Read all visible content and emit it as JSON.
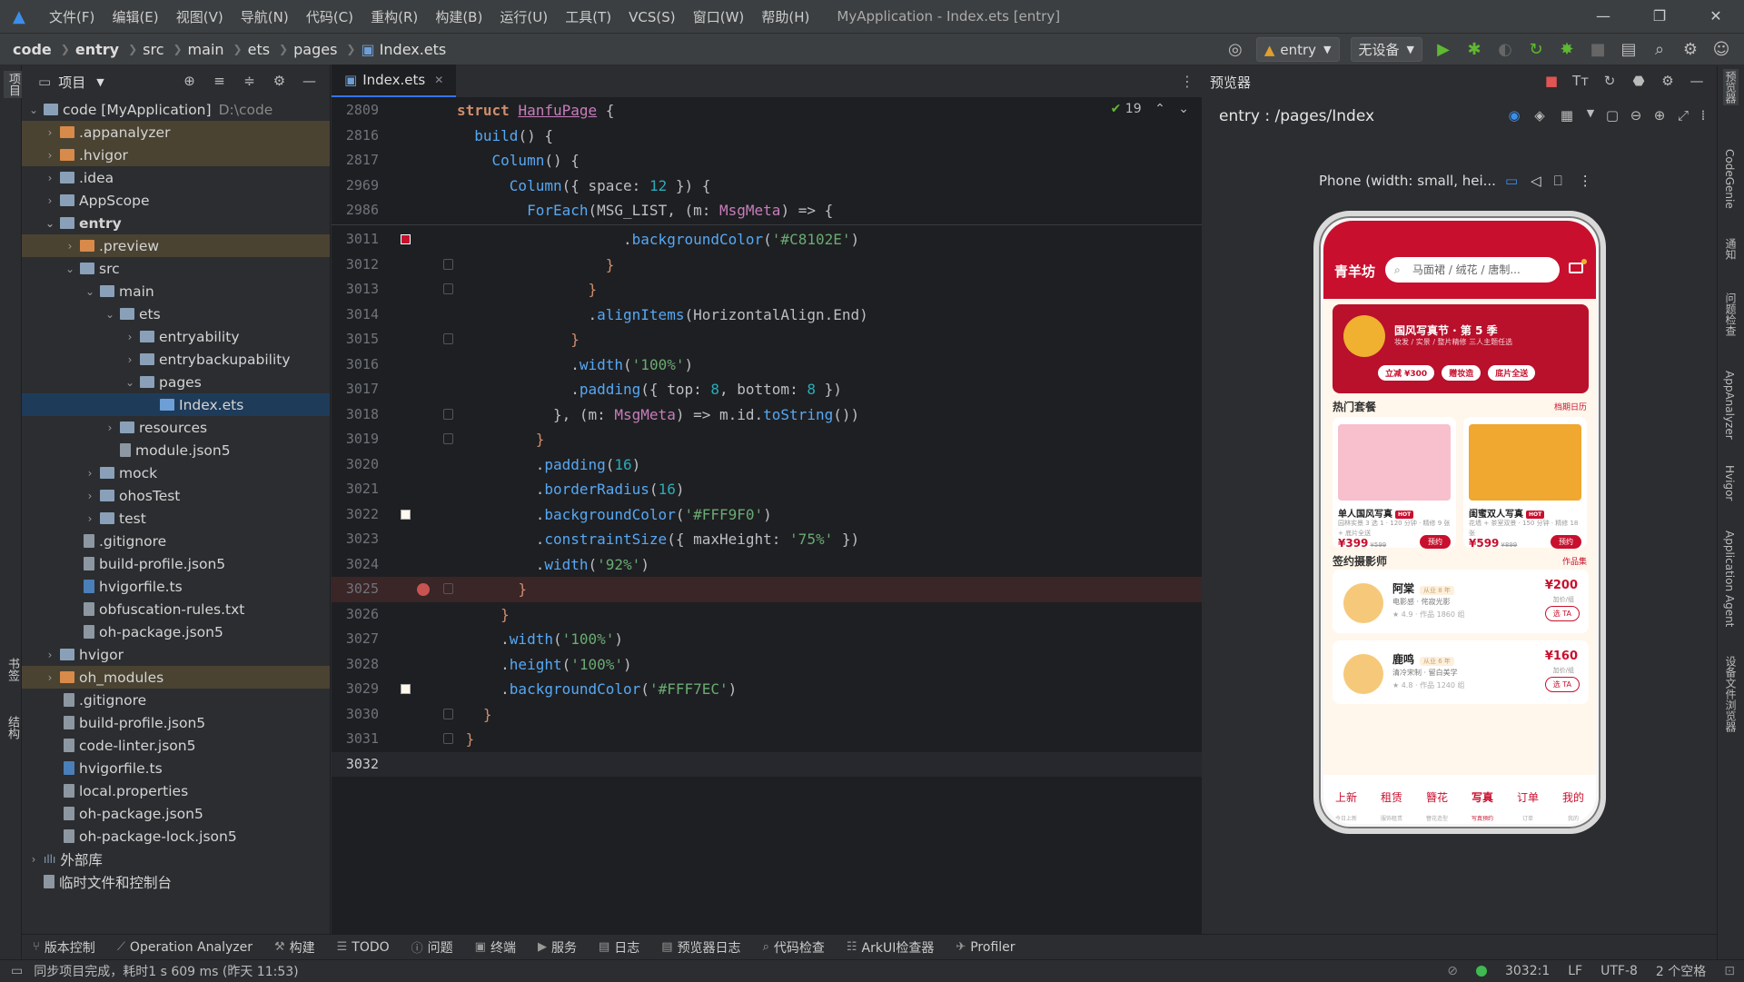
{
  "app": {
    "menu": [
      "文件(F)",
      "编辑(E)",
      "视图(V)",
      "导航(N)",
      "代码(C)",
      "重构(R)",
      "构建(B)",
      "运行(U)",
      "工具(T)",
      "VCS(S)",
      "窗口(W)",
      "帮助(H)"
    ],
    "window_title": "MyApplication - Index.ets [entry]"
  },
  "breadcrumb": [
    "code",
    "entry",
    "src",
    "main",
    "ets",
    "pages",
    "Index.ets"
  ],
  "toolbar": {
    "module": "entry",
    "device": "无设备"
  },
  "project": {
    "title": "项目",
    "tree": [
      {
        "label": "code [MyApplication]",
        "note": "D:\\code"
      },
      {
        "label": ".appanalyzer"
      },
      {
        "label": ".hvigor"
      },
      {
        "label": ".idea"
      },
      {
        "label": "AppScope"
      },
      {
        "label": "entry"
      },
      {
        "label": ".preview"
      },
      {
        "label": "src"
      },
      {
        "label": "main"
      },
      {
        "label": "ets"
      },
      {
        "label": "entryability"
      },
      {
        "label": "entrybackupability"
      },
      {
        "label": "pages"
      },
      {
        "label": "Index.ets"
      },
      {
        "label": "resources"
      },
      {
        "label": "module.json5"
      },
      {
        "label": "mock"
      },
      {
        "label": "ohosTest"
      },
      {
        "label": "test"
      },
      {
        "label": ".gitignore"
      },
      {
        "label": "build-profile.json5"
      },
      {
        "label": "hvigorfile.ts"
      },
      {
        "label": "obfuscation-rules.txt"
      },
      {
        "label": "oh-package.json5"
      },
      {
        "label": "hvigor"
      },
      {
        "label": "oh_modules"
      },
      {
        "label": ".gitignore"
      },
      {
        "label": "build-profile.json5"
      },
      {
        "label": "code-linter.json5"
      },
      {
        "label": "hvigorfile.ts"
      },
      {
        "label": "local.properties"
      },
      {
        "label": "oh-package.json5"
      },
      {
        "label": "oh-package-lock.json5"
      },
      {
        "label": "外部库"
      },
      {
        "label": "临时文件和控制台"
      }
    ]
  },
  "editor": {
    "tab": "Index.ets",
    "inspection_count": "19",
    "sticky": [
      {
        "n": "2809",
        "code": "struct HanfuPage {"
      },
      {
        "n": "2816",
        "code": "  build() {"
      },
      {
        "n": "2817",
        "code": "    Column() {"
      },
      {
        "n": "2969",
        "code": "      Column({ space: 12 }) {"
      },
      {
        "n": "2986",
        "code": "        ForEach(MSG_LIST, (m: MsgMeta) => {"
      }
    ],
    "lines": [
      {
        "n": "3011",
        "code": "                   .backgroundColor('#C8102E')"
      },
      {
        "n": "3012",
        "code": "                 }"
      },
      {
        "n": "3013",
        "code": "               }"
      },
      {
        "n": "3014",
        "code": "               .alignItems(HorizontalAlign.End)"
      },
      {
        "n": "3015",
        "code": "             }"
      },
      {
        "n": "3016",
        "code": "             .width('100%')"
      },
      {
        "n": "3017",
        "code": "             .padding({ top: 8, bottom: 8 })"
      },
      {
        "n": "3018",
        "code": "           }, (m: MsgMeta) => m.id.toString())"
      },
      {
        "n": "3019",
        "code": "         }"
      },
      {
        "n": "3020",
        "code": "         .padding(16)"
      },
      {
        "n": "3021",
        "code": "         .borderRadius(16)"
      },
      {
        "n": "3022",
        "code": "         .backgroundColor('#FFF9F0')"
      },
      {
        "n": "3023",
        "code": "         .constraintSize({ maxHeight: '75%' })"
      },
      {
        "n": "3024",
        "code": "         .width('92%')"
      },
      {
        "n": "3025",
        "code": "       }"
      },
      {
        "n": "3026",
        "code": "     }"
      },
      {
        "n": "3027",
        "code": "     .width('100%')"
      },
      {
        "n": "3028",
        "code": "     .height('100%')"
      },
      {
        "n": "3029",
        "code": "     .backgroundColor('#FFF7EC')"
      },
      {
        "n": "3030",
        "code": "   }"
      },
      {
        "n": "3031",
        "code": " }"
      },
      {
        "n": "3032",
        "code": ""
      }
    ]
  },
  "previewer": {
    "title": "预览器",
    "path": "entry : /pages/Index",
    "device": "Phone (width: small, hei...",
    "phone": {
      "brand": "青羊坊",
      "search": "马面裙 / 绒花 / 唐制...",
      "banner_title": "国风写真节 · 第 5 季",
      "banner_sub": "妆发 / 实景 / 整片精修 三人主题任选",
      "chips": [
        "立减 ¥300",
        "赠妆造",
        "底片全送"
      ],
      "sec1": "热门套餐",
      "sec1_more": "档期日历",
      "cards": [
        {
          "title": "单人国风写真",
          "hot": "HOT",
          "desc": "园林实景 3 选 1 · 120 分钟 · 精修 9 张 + 底片全送",
          "price": "¥399",
          "old": "¥599",
          "btn": "预约"
        },
        {
          "title": "闺蜜双人写真",
          "hot": "HOT",
          "desc": "花墙 + 茶室双景 · 150 分钟 · 精修 18 张",
          "price": "¥599",
          "old": "¥899",
          "btn": "预约"
        }
      ],
      "sec2": "签约摄影师",
      "sec2_more": "作品集",
      "photographers": [
        {
          "name": "阿棠",
          "tag": "从业 8 年",
          "desc": "电影感 · 侘寂光影",
          "rating": "★ 4.9 · 作品 1860 组",
          "price": "¥200",
          "unit": "加价/组",
          "btn": "选 TA"
        },
        {
          "name": "鹿鸣",
          "tag": "从业 6 年",
          "desc": "清冷宋制 · 留白美学",
          "rating": "★ 4.8 · 作品 1240 组",
          "price": "¥160",
          "unit": "加价/组",
          "btn": "选 TA"
        }
      ],
      "tabs": [
        {
          "a": "上新",
          "b": "今日上新"
        },
        {
          "a": "租赁",
          "b": "服饰租赁"
        },
        {
          "a": "簪花",
          "b": "簪花造型"
        },
        {
          "a": "写真",
          "b": "写真预约"
        },
        {
          "a": "订单",
          "b": "订单"
        },
        {
          "a": "我的",
          "b": "我的"
        }
      ]
    }
  },
  "right_strip": [
    "预览器",
    "CodeGenie",
    "通知",
    "问题检查",
    "AppAnalyzer",
    "Hvigor",
    "Application Agent",
    "设备文件浏览器"
  ],
  "left_strip": [
    "项目",
    "书签",
    "结构"
  ],
  "bottom_tools": [
    "版本控制",
    "Operation Analyzer",
    "构建",
    "TODO",
    "问题",
    "终端",
    "服务",
    "日志",
    "预览器日志",
    "代码检查",
    "ArkUI检查器",
    "Profiler"
  ],
  "status": {
    "message": "同步项目完成，耗时1 s 609 ms (昨天 11:53)",
    "position": "3032:1",
    "line_sep": "LF",
    "encoding": "UTF-8",
    "indent": "2 个空格"
  },
  "colors": {
    "brand": "#C8102E",
    "panel": "#FFF9F0",
    "page": "#FFF7EC"
  }
}
